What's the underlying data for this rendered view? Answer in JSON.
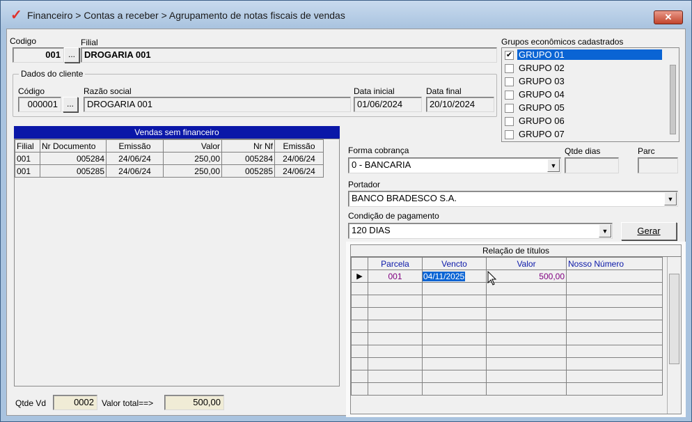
{
  "window": {
    "title": "Financeiro > Contas a receber > Agrupamento de notas fiscais de vendas",
    "close_label": "✕"
  },
  "header": {
    "codigo_label": "Codigo",
    "codigo_value": "001",
    "codigo_lookup": "...",
    "filial_label": "Filial",
    "filial_value": "DROGARIA 001"
  },
  "cliente": {
    "group_title": "Dados do cliente",
    "codigo_label": "Código",
    "codigo_value": "000001",
    "codigo_lookup": "...",
    "razao_label": "Razão social",
    "razao_value": "DROGARIA 001",
    "data_inicial_label": "Data inicial",
    "data_inicial_value": "01/06/2024",
    "data_final_label": "Data final",
    "data_final_value": "20/10/2024"
  },
  "grupos": {
    "title": "Grupos econômicos cadastrados",
    "items": [
      {
        "label": "GRUPO 01",
        "checked": "✔"
      },
      {
        "label": "GRUPO 02",
        "checked": ""
      },
      {
        "label": "GRUPO 03",
        "checked": ""
      },
      {
        "label": "GRUPO 04",
        "checked": ""
      },
      {
        "label": "GRUPO 05",
        "checked": ""
      },
      {
        "label": "GRUPO 06",
        "checked": ""
      },
      {
        "label": "GRUPO 07",
        "checked": ""
      }
    ]
  },
  "vendas": {
    "title": "Vendas sem financeiro",
    "columns": [
      "Filial",
      "Nr Documento",
      "Emissão",
      "Valor",
      "Nr Nf",
      "Emissão"
    ],
    "rows": [
      [
        "001",
        "005284",
        "24/06/24",
        "250,00",
        "005284",
        "24/06/24"
      ],
      [
        "001",
        "005285",
        "24/06/24",
        "250,00",
        "005285",
        "24/06/24"
      ]
    ]
  },
  "totais": {
    "qtde_label": "Qtde Vd",
    "qtde_value": "0002",
    "valor_label": "Valor total==>",
    "valor_value": "500,00"
  },
  "cobranca": {
    "forma_label": "Forma cobrança",
    "forma_value": "0 - BANCARIA",
    "qtde_dias_label": "Qtde dias",
    "qtde_dias_value": "",
    "parc_label": "Parc",
    "parc_value": "",
    "portador_label": "Portador",
    "portador_value": "BANCO BRADESCO S.A.",
    "condicao_label": "Condição de pagamento",
    "condicao_value": "120 DIAS",
    "gerar_label": "Gerar"
  },
  "titulos": {
    "title": "Relação de títulos",
    "columns": [
      "Parcela",
      "Vencto",
      "Valor",
      "Nosso Número"
    ],
    "rows": [
      {
        "parcela": "001",
        "vencto": "04/11/2025",
        "valor": "500,00",
        "nosso_numero": ""
      }
    ],
    "row_indicator": "▶"
  },
  "colors": {
    "title_blue": "#0a17a8",
    "purple_text": "#800080",
    "selection": "#0a64d4"
  }
}
